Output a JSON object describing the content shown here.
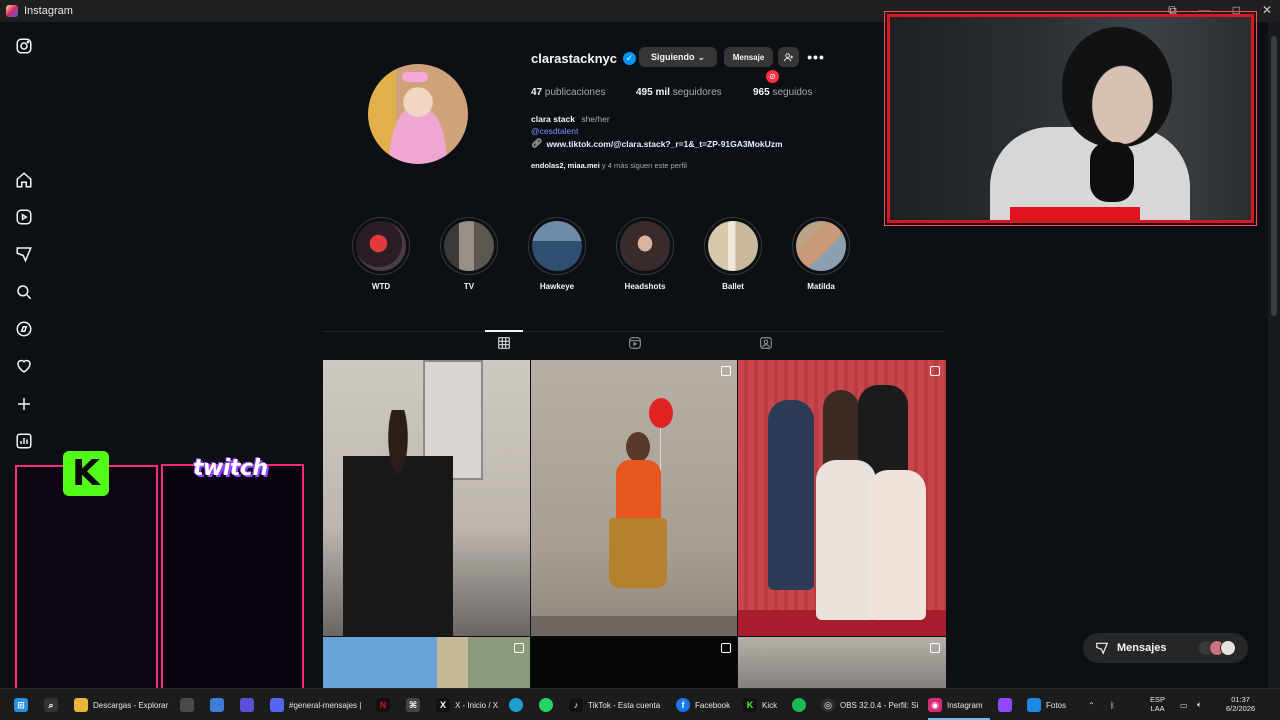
{
  "window": {
    "title": "Instagram",
    "controls": [
      "⧉",
      "—",
      "□",
      "✕"
    ]
  },
  "sidebar": {
    "items": [
      {
        "name": "instagram-logo-icon"
      },
      {
        "name": "home-icon"
      },
      {
        "name": "reels-icon"
      },
      {
        "name": "direct-icon"
      },
      {
        "name": "search-icon"
      },
      {
        "name": "explore-icon"
      },
      {
        "name": "notifications-heart-icon"
      },
      {
        "name": "create-plus-icon"
      },
      {
        "name": "dashboard-icon"
      }
    ]
  },
  "profile": {
    "username": "clarastacknyc",
    "following_button": "Siguiendo",
    "message_button": "Mensaje",
    "notification_count": "",
    "stats": {
      "posts_count": "47",
      "posts_label": "publicaciones",
      "followers_count": "495 mil",
      "followers_label": "seguidores",
      "following_count": "965",
      "following_label": "seguidos"
    },
    "bio": {
      "name": "clara stack",
      "pronouns": "she/her",
      "mention": "@cesdtalent",
      "link": "www.tiktok.com/@clara.stack?_r=1&_t=ZP-91GA3MokUzm"
    },
    "followed_by": {
      "users": "endolas2, miaa.mei",
      "suffix": "y 4 más siguen este perfil"
    }
  },
  "highlights": [
    {
      "label": "WTD",
      "color": "#a8202c"
    },
    {
      "label": "TV",
      "color": "#6b6760"
    },
    {
      "label": "Hawkeye",
      "color": "#2e4f72"
    },
    {
      "label": "Headshots",
      "color": "#3a2a2a"
    },
    {
      "label": "Ballet",
      "color": "#c9b89b"
    },
    {
      "label": "Matilda",
      "color": "#c99a7a"
    }
  ],
  "tabs": [
    {
      "name": "posts-grid-tab",
      "active": true
    },
    {
      "name": "reels-tab",
      "active": false
    },
    {
      "name": "tagged-tab",
      "active": false
    }
  ],
  "messages": {
    "label": "Mensajes"
  },
  "overlay": {
    "kick_logo": "K",
    "twitch_logo": "twitch"
  },
  "taskbar": {
    "items": [
      {
        "label": "Descargas - Explorar",
        "icon": "folder-icon",
        "color": "#e8b43a"
      },
      {
        "label": "#general-mensajes |",
        "icon": "discord-icon",
        "color": "#5865f2"
      },
      {
        "label": "X - Inicio / X",
        "icon": "x-icon",
        "color": "#111111"
      },
      {
        "label": "TikTok - Esta cuenta",
        "icon": "tiktok-icon",
        "color": "#111111"
      },
      {
        "label": "Facebook",
        "icon": "facebook-icon",
        "color": "#1877f2"
      },
      {
        "label": "Kick",
        "icon": "kick-icon",
        "color": "#53fc18"
      },
      {
        "label": "OBS 32.0.4 - Perfil: Si",
        "icon": "obs-icon",
        "color": "#302e31"
      },
      {
        "label": "Instagram",
        "icon": "instagram-icon",
        "color": "#d62976"
      },
      {
        "label": "Fotos",
        "icon": "photos-icon",
        "color": "#1e88e5"
      }
    ],
    "lang_top": "ESP",
    "lang_bottom": "LAA",
    "time": "01:37",
    "date": "6/2/2026"
  }
}
